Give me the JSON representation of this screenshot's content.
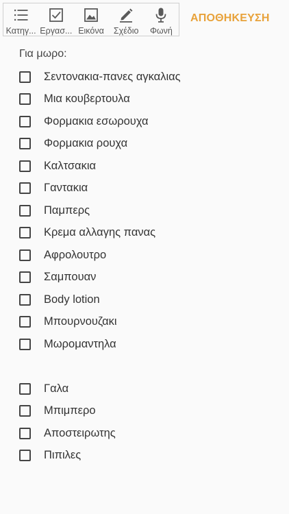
{
  "toolbar": {
    "items": [
      {
        "label": "Κατηγ...",
        "icon": "list-icon"
      },
      {
        "label": "Εργασ...",
        "icon": "checkbox-icon"
      },
      {
        "label": "Εικόνα",
        "icon": "image-icon"
      },
      {
        "label": "Σχέδιο",
        "icon": "pen-icon"
      },
      {
        "label": "Φωνή",
        "icon": "microphone-icon"
      }
    ]
  },
  "save_label": "ΑΠΟΘΗΚΕΥΣΗ",
  "note": {
    "heading": "Για μωρο:",
    "items": [
      {
        "text": "Σεντονακια-πανες αγκαλιας",
        "checked": false
      },
      {
        "text": "Μια κουβερτουλα",
        "checked": false
      },
      {
        "text": "Φορμακια εσωρουχα",
        "checked": false
      },
      {
        "text": "Φορμακια ρουχα",
        "checked": false
      },
      {
        "text": "Καλτσακια",
        "checked": false
      },
      {
        "text": "Γαντακια",
        "checked": false
      },
      {
        "text": "Παμπερς",
        "checked": false
      },
      {
        "text": "Κρεμα αλλαγης πανας",
        "checked": false
      },
      {
        "text": "Αφρολουτρο",
        "checked": false
      },
      {
        "text": "Σαμπουαν",
        "checked": false
      },
      {
        "text": "Body lotion",
        "checked": false
      },
      {
        "text": "Μπουρνουζακι",
        "checked": false
      },
      {
        "text": "Μωρομαντηλα",
        "checked": false
      },
      {
        "text": "",
        "checked": false,
        "blank": true
      },
      {
        "text": "Γαλα",
        "checked": false
      },
      {
        "text": "Μπιμπερο",
        "checked": false
      },
      {
        "text": "Αποστειρωτης",
        "checked": false
      },
      {
        "text": "Πιπιλες",
        "checked": false
      }
    ]
  },
  "colors": {
    "accent": "#e8a23a",
    "icon": "#5a5a5a",
    "background": "#fafafa"
  }
}
